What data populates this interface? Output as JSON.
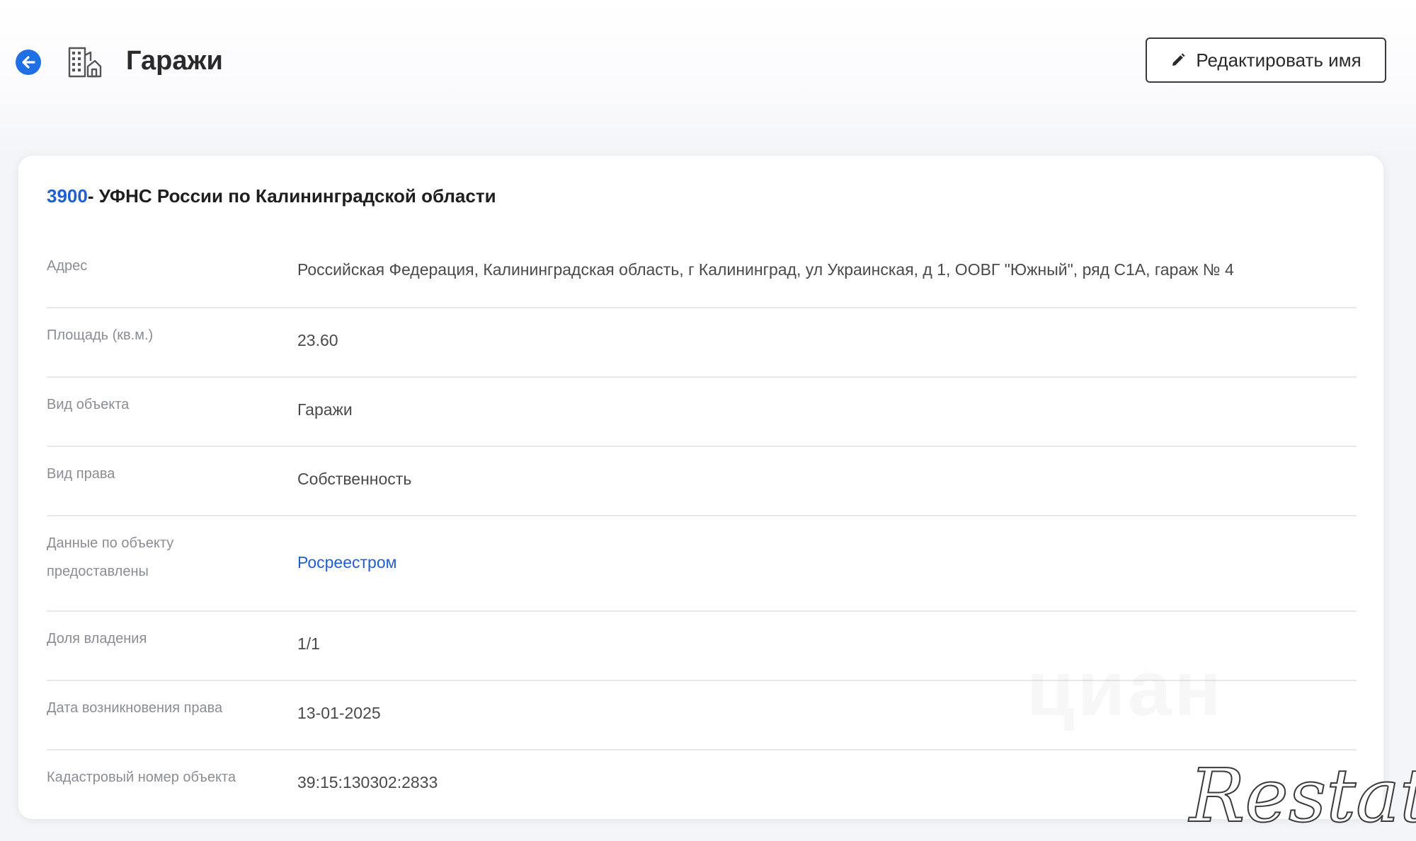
{
  "header": {
    "title": "Гаражи",
    "edit_button_label": "Редактировать имя",
    "back_icon": "arrow-left-circle-icon",
    "object_icon": "building-icon",
    "edit_icon": "pencil-icon"
  },
  "card": {
    "code": "3900",
    "org_name": "- УФНС России по Калининградской области",
    "rows": [
      {
        "label": "Адрес",
        "value": "Российская Федерация, Калининградская область, г Калининград, ул Украинская, д 1, ООВГ \"Южный\", ряд С1А, гараж № 4"
      },
      {
        "label": "Площадь (кв.м.)",
        "value": "23.60"
      },
      {
        "label": "Вид объекта",
        "value": "Гаражи"
      },
      {
        "label": "Вид права",
        "value": "Собственность"
      },
      {
        "label": "Данные по объекту предоставлены",
        "value": "Росреестром"
      },
      {
        "label": "Доля владения",
        "value": "1/1"
      },
      {
        "label": "Дата возникновения права",
        "value": "13-01-2025"
      },
      {
        "label": "Кадастровый номер объекта",
        "value": "39:15:130302:2833"
      }
    ]
  },
  "watermarks": {
    "cian": "циан",
    "restate": "Restate"
  },
  "colors": {
    "accent": "#1f5fd6",
    "back_button": "#1f6fe5",
    "label": "#8a8d93",
    "value": "#4a4a4a"
  }
}
